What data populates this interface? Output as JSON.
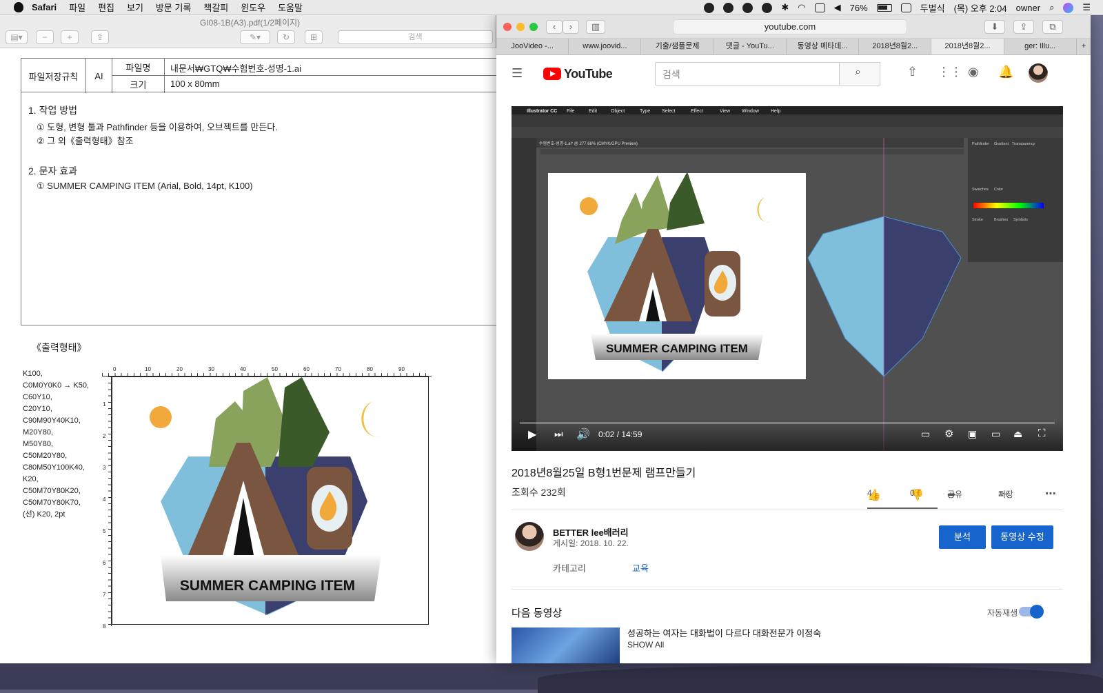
{
  "menubar": {
    "app": "Safari",
    "items": [
      "파일",
      "편집",
      "보기",
      "방문 기록",
      "책갈피",
      "윈도우",
      "도움말"
    ],
    "battery": "76%",
    "input": "두벌식",
    "clock": "(목) 오후 2:04",
    "user": "owner"
  },
  "preview": {
    "title": "GI08-1B(A3).pdf(1/2페이지)",
    "search_placeholder": "검색",
    "table": {
      "rule_label": "파일저장규칙",
      "format": "AI",
      "filename_label": "파일명",
      "filename_value": "내문서₩GTQ₩수험번호-성명-1.ai",
      "size_label": "크기",
      "size_value": "100 x 80mm"
    },
    "section1_title": "1. 작업 방법",
    "section1_items": [
      "① 도형, 변형 툴과 Pathfinder 등을 이용하여, 오브젝트를 만든다.",
      "② 그 외《출력형태》참조"
    ],
    "section2_title": "2. 문자 효과",
    "section2_items": [
      "① SUMMER CAMPING ITEM (Arial, Bold, 14pt, K100)"
    ],
    "output_label": "《출력형태》",
    "colors": [
      "K100,",
      "C0M0Y0K0 → K50,",
      "C60Y10,",
      "C20Y10,",
      "C90M90Y40K10,",
      "M20Y80,",
      "M50Y80,",
      "C50M20Y80,",
      "C80M50Y100K40,",
      "K20,",
      "C50M70Y80K20,",
      "C50M70Y80K70,",
      "(선) K20, 2pt"
    ],
    "ruler_top": [
      "0",
      "10",
      "20",
      "30",
      "40",
      "50",
      "60",
      "70",
      "80",
      "90"
    ],
    "ruler_left": [
      "1",
      "2",
      "3",
      "4",
      "5",
      "6",
      "7",
      "8"
    ],
    "art_text": "SUMMER CAMPING ITEM"
  },
  "safari": {
    "url": "youtube.com",
    "tabs": [
      "JooVideo -...",
      "www.joovid...",
      "기출/샘플문제",
      "댓글 - YouTu...",
      "동영상 메타데...",
      "2018년8월2...",
      "2018년8월2...",
      "ger: Illu..."
    ],
    "active_tab": 6
  },
  "youtube": {
    "brand": "YouTube",
    "search_placeholder": "검색",
    "illustrator_menu": [
      "Illustrator CC",
      "File",
      "Edit",
      "Object",
      "Type",
      "Select",
      "Effect",
      "View",
      "Window",
      "Help"
    ],
    "illustrator_tab": "수험번호-성명-1.ai* @ 277.66% (CMYK/GPU Preview)",
    "panel_labels": [
      "Pathfinder",
      "Gradient",
      "Transparency",
      "Swatches",
      "Color",
      "Stroke",
      "Brushes",
      "Symbols"
    ],
    "time": "0:02 / 14:59",
    "video_title": "2018년8월25일 B형1번문제 램프만들기",
    "views": "조회수 232회",
    "likes": "4",
    "dislikes": "0",
    "share": "공유",
    "save": "저장",
    "channel": "BETTER lee배러리",
    "published": "게시일: 2018. 10. 22.",
    "category_label": "카테고리",
    "category_value": "교육",
    "analytics_button": "분석",
    "edit_button": "동영상 수정",
    "next_label": "다음 동영상",
    "autoplay_label": "자동재생",
    "next_title": "성공하는 여자는 대화법이 다르다 대화전문가 이정숙",
    "next_show_all": "SHOW All"
  },
  "colors": {
    "youtube_red": "#ff0000",
    "button_blue": "#1765cc",
    "sky": "#7fbfdc",
    "navy": "#3b3f6e",
    "tent": "#7a5540",
    "tree_light": "#8aa35c",
    "tree_dark": "#3b5a2a"
  }
}
